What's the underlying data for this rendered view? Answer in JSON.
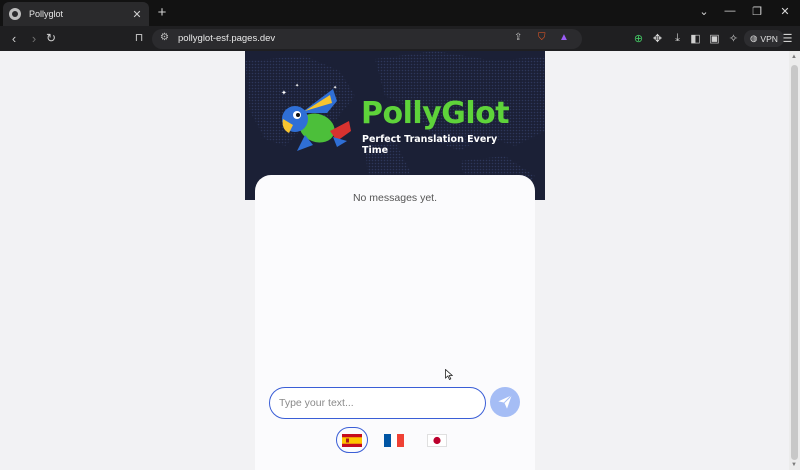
{
  "browser": {
    "tab": {
      "title": "Pollyglot",
      "favicon": "globe-icon"
    },
    "url": "pollyglot-esf.pages.dev",
    "vpn_label": "VPN"
  },
  "app": {
    "brand": "PollyGlot",
    "tagline": "Perfect Translation Every Time",
    "empty_message": "No messages yet.",
    "input_placeholder": "Type your text...",
    "languages": [
      {
        "name": "Spanish",
        "icon": "spain-flag-icon",
        "selected": true
      },
      {
        "name": "French",
        "icon": "france-flag-icon",
        "selected": false
      },
      {
        "name": "Japanese",
        "icon": "japan-flag-icon",
        "selected": false
      }
    ]
  },
  "colors": {
    "accent": "#3a5ed6",
    "send_button": "#a5bdf5",
    "brand_green": "#5ed33a",
    "hero_bg": "#1b2036"
  }
}
